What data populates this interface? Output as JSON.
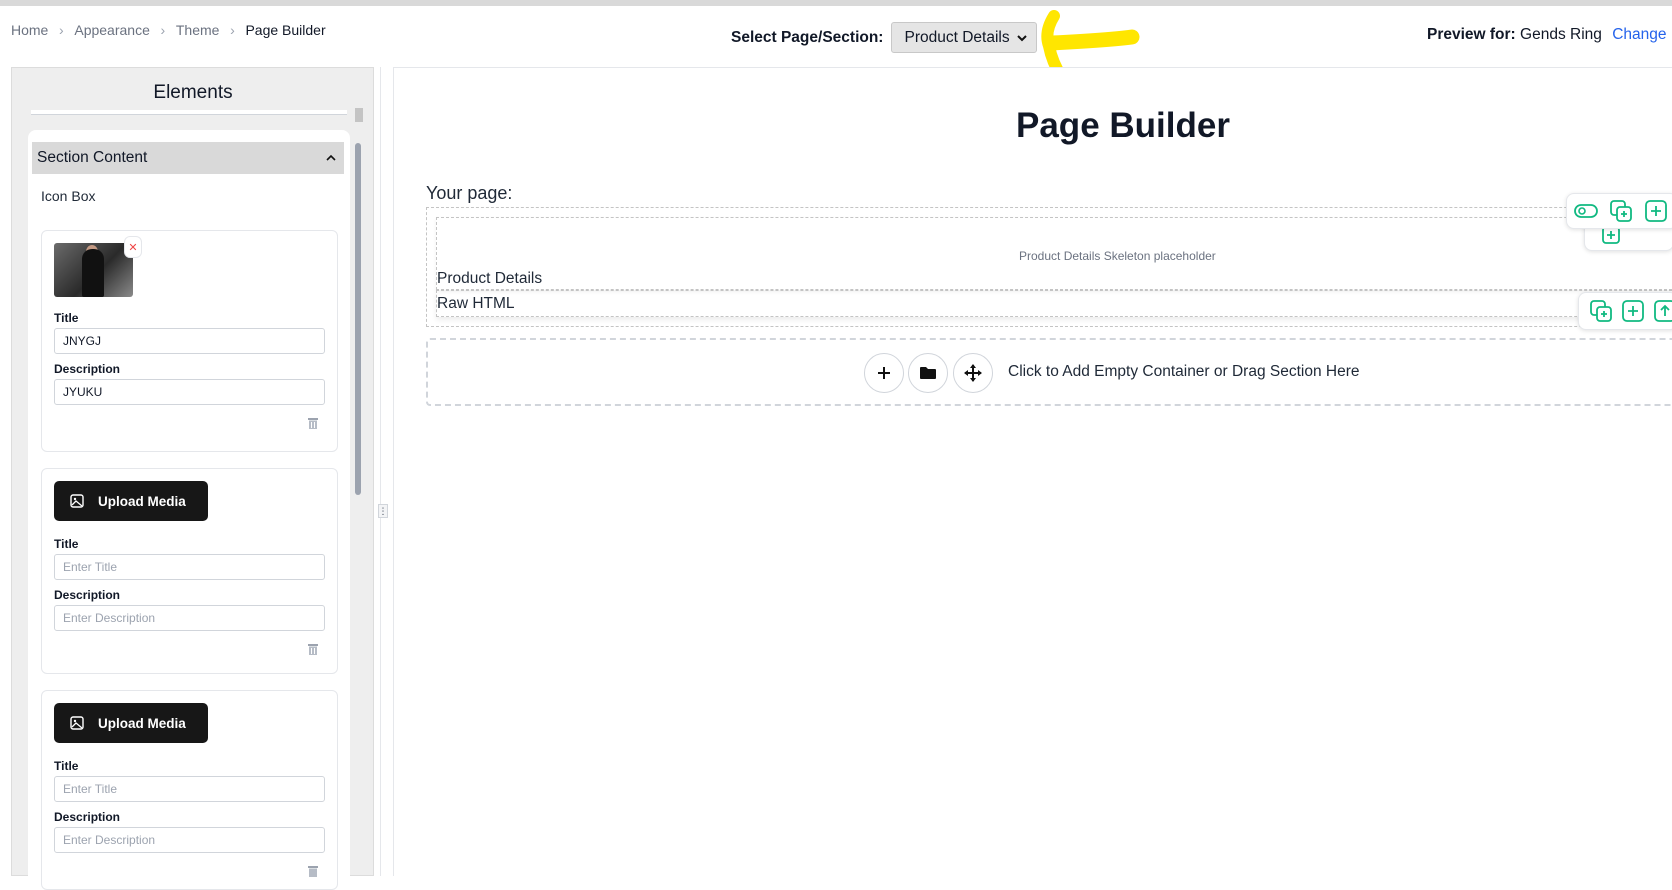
{
  "breadcrumb": [
    "Home",
    "Appearance",
    "Theme",
    "Page Builder"
  ],
  "page_select": {
    "label": "Select Page/Section:",
    "value": "Product Details"
  },
  "preview": {
    "label": "Preview for:",
    "product": "Gends Ring",
    "change": "Change"
  },
  "sidebar": {
    "title": "Elements",
    "section_title": "Section Content",
    "group_label": "Icon Box",
    "items": [
      {
        "title_label": "Title",
        "title_value": "JNYGJ",
        "desc_label": "Description",
        "desc_value": "JYUKU"
      },
      {
        "upload_label": "Upload Media",
        "title_label": "Title",
        "title_placeholder": "Enter Title",
        "desc_label": "Description",
        "desc_placeholder": "Enter Description"
      },
      {
        "upload_label": "Upload Media",
        "title_label": "Title",
        "title_placeholder": "Enter Title",
        "desc_label": "Description",
        "desc_placeholder": "Enter Description"
      }
    ]
  },
  "canvas": {
    "title": "Page Builder",
    "your_page": "Your page:",
    "product_details_placeholder": "Product Details Skeleton placeholder",
    "sections": [
      "Product Details",
      "Raw HTML"
    ],
    "add_text": "Click to Add Empty Container or Drag Section Here"
  },
  "colors": {
    "accent": "#10b981",
    "link": "#2563eb",
    "highlight": "#ffe600",
    "button_dark": "#171717"
  }
}
